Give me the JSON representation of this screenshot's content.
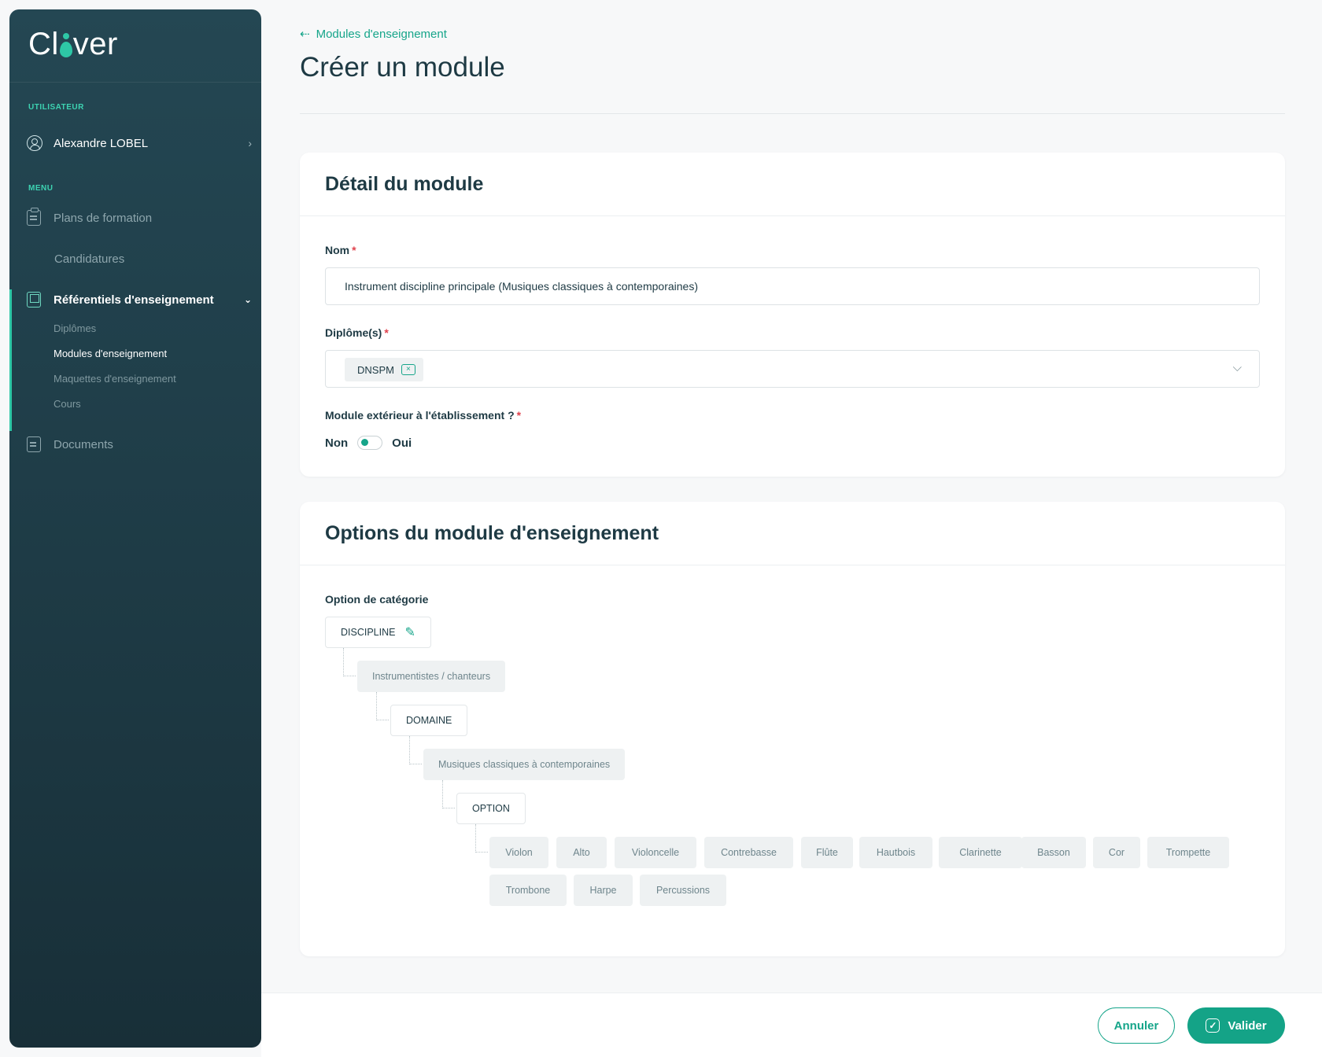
{
  "app": {
    "logo_text_left": "Cl",
    "logo_text_right": "ver"
  },
  "sidebar": {
    "user_section_label": "UTILISATEUR",
    "user_name": "Alexandre LOBEL",
    "menu_section_label": "MENU",
    "items": [
      {
        "label": "Plans de formation",
        "icon": "clipboard-icon"
      },
      {
        "label": "Candidatures",
        "icon": "id-card-icon"
      },
      {
        "label": "Référentiels d'enseignement",
        "icon": "book-icon",
        "active": true
      },
      {
        "label": "Documents",
        "icon": "document-icon"
      }
    ],
    "sub_items": [
      {
        "label": "Diplômes"
      },
      {
        "label": "Modules d'enseignement",
        "active": true
      },
      {
        "label": "Maquettes d'enseignement"
      },
      {
        "label": "Cours"
      }
    ]
  },
  "header": {
    "breadcrumb": "Modules d'enseignement",
    "title": "Créer un module"
  },
  "detail": {
    "title": "Détail du module",
    "name_label": "Nom",
    "name_value": "Instrument discipline principale (Musiques classiques à contemporaines)",
    "diplomas_label": "Diplôme(s)",
    "diploma_chip": "DNSPM",
    "external_label": "Module extérieur à l'établissement ?",
    "toggle_off": "Non",
    "toggle_on": "Oui",
    "required_mark": "*"
  },
  "options": {
    "title": "Options du module d'enseignement",
    "category_label": "Option de catégorie",
    "tree": {
      "discipline": "DISCIPLINE",
      "discipline_value": "Instrumentistes / chanteurs",
      "domaine": "DOMAINE",
      "domaine_value": "Musiques classiques à contemporaines",
      "option": "OPTION"
    },
    "instruments": [
      "Violon",
      "Alto",
      "Violoncelle",
      "Contrebasse",
      "Flûte",
      "Hautbois",
      "Clarinette",
      "Basson",
      "Cor",
      "Trompette",
      "Trombone",
      "Harpe",
      "Percussions"
    ]
  },
  "footer": {
    "cancel": "Annuler",
    "validate": "Valider"
  },
  "colors": {
    "accent": "#16a58a",
    "sidebar": "#1f3d48",
    "required": "#e0424d"
  }
}
